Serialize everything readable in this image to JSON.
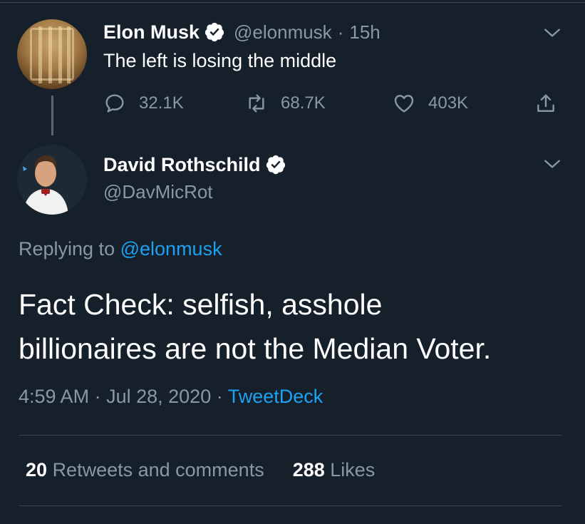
{
  "parent_tweet": {
    "display_name": "Elon Musk",
    "handle": "@elonmusk",
    "separator": "·",
    "time": "15h",
    "text": "The left is losing the middle",
    "actions": {
      "reply_count": "32.1K",
      "retweet_count": "68.7K",
      "like_count": "403K"
    }
  },
  "reply_tweet": {
    "display_name": "David Rothschild",
    "handle": "@DavMicRot",
    "replying_prefix": "Replying to",
    "replying_to": "@elonmusk",
    "text_line1": "Fact Check: selfish, asshole",
    "text_line2": "billionaires are not the Median Voter.",
    "time": "4:59 AM",
    "date": "Jul 28, 2020",
    "separator": "·",
    "source": "TweetDeck",
    "stats": {
      "retweets_count": "20",
      "retweets_label": "Retweets and comments",
      "likes_count": "288",
      "likes_label": "Likes"
    }
  },
  "colors": {
    "background": "#15202b",
    "primary_text": "#ffffff",
    "secondary_text": "#8899a6",
    "accent": "#1da1f2",
    "divider": "#38444d"
  },
  "icons": {
    "verified": "verified-badge-icon",
    "caret": "chevron-down-icon",
    "reply": "reply-icon",
    "retweet": "retweet-icon",
    "like": "heart-icon",
    "share": "share-icon"
  }
}
